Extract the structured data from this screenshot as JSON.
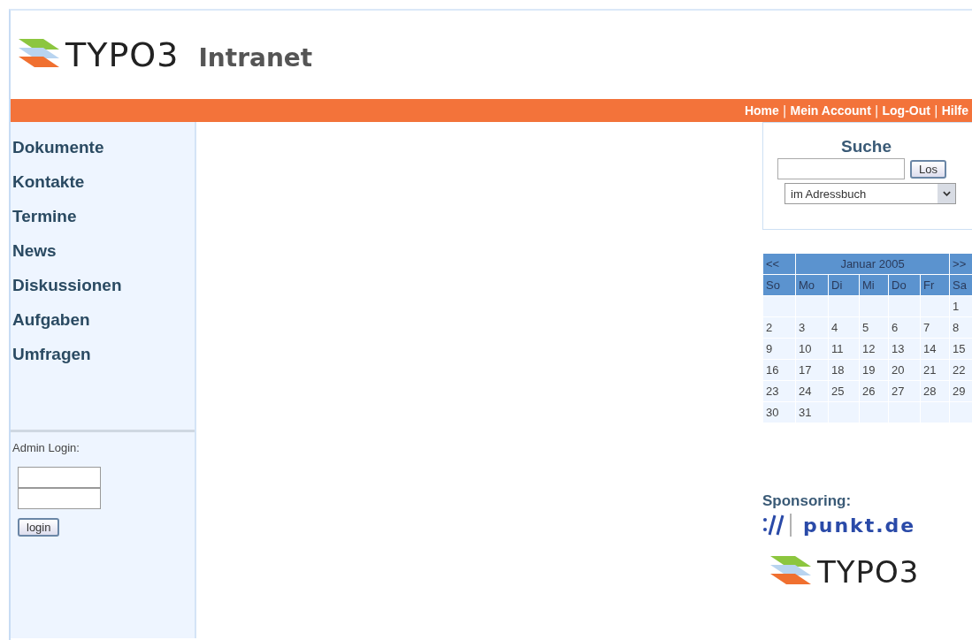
{
  "header": {
    "logo": "TYPO3",
    "title": "Intranet"
  },
  "top_links": [
    {
      "kind": "link",
      "text": "Home"
    },
    {
      "kind": "separator",
      "text": "|"
    },
    {
      "kind": "link",
      "text": "Mein Account"
    },
    {
      "kind": "separator",
      "text": "|"
    },
    {
      "kind": "link",
      "text": "Log-Out"
    },
    {
      "kind": "separator",
      "text": "|"
    },
    {
      "kind": "link",
      "text": "Hilfe"
    }
  ],
  "sidebar": {
    "items": [
      "Dokumente",
      "Kontakte",
      "Termine",
      "News",
      "Diskussionen",
      "Aufgaben",
      "Umfragen"
    ],
    "login": {
      "label": "Admin Login:",
      "button": "login"
    }
  },
  "search": {
    "title": "Suche",
    "button": "Los",
    "scope": "im Adressbuch"
  },
  "calendar": {
    "prev": "<<",
    "month": "Januar 2005",
    "next": ">>",
    "weekdays": [
      "So",
      "Mo",
      "Di",
      "Mi",
      "Do",
      "Fr",
      "Sa"
    ],
    "weeks": [
      {
        "kind": "first",
        "days": [
          "1"
        ]
      },
      {
        "kind": "full",
        "days": [
          "2",
          "3",
          "4",
          "5",
          "6",
          "7",
          "8"
        ]
      },
      {
        "kind": "full",
        "days": [
          "9",
          "10",
          "11",
          "12",
          "13",
          "14",
          "15"
        ]
      },
      {
        "kind": "full",
        "days": [
          "16",
          "17",
          "18",
          "19",
          "20",
          "21",
          "22"
        ]
      },
      {
        "kind": "full",
        "days": [
          "23",
          "24",
          "25",
          "26",
          "27",
          "28",
          "29"
        ]
      },
      {
        "kind": "last",
        "days": [
          "30",
          "31"
        ]
      }
    ]
  },
  "sponsoring": {
    "label": "Sponsoring:",
    "sponsor": "punkt.de",
    "footer_logo": "TYPO3"
  }
}
